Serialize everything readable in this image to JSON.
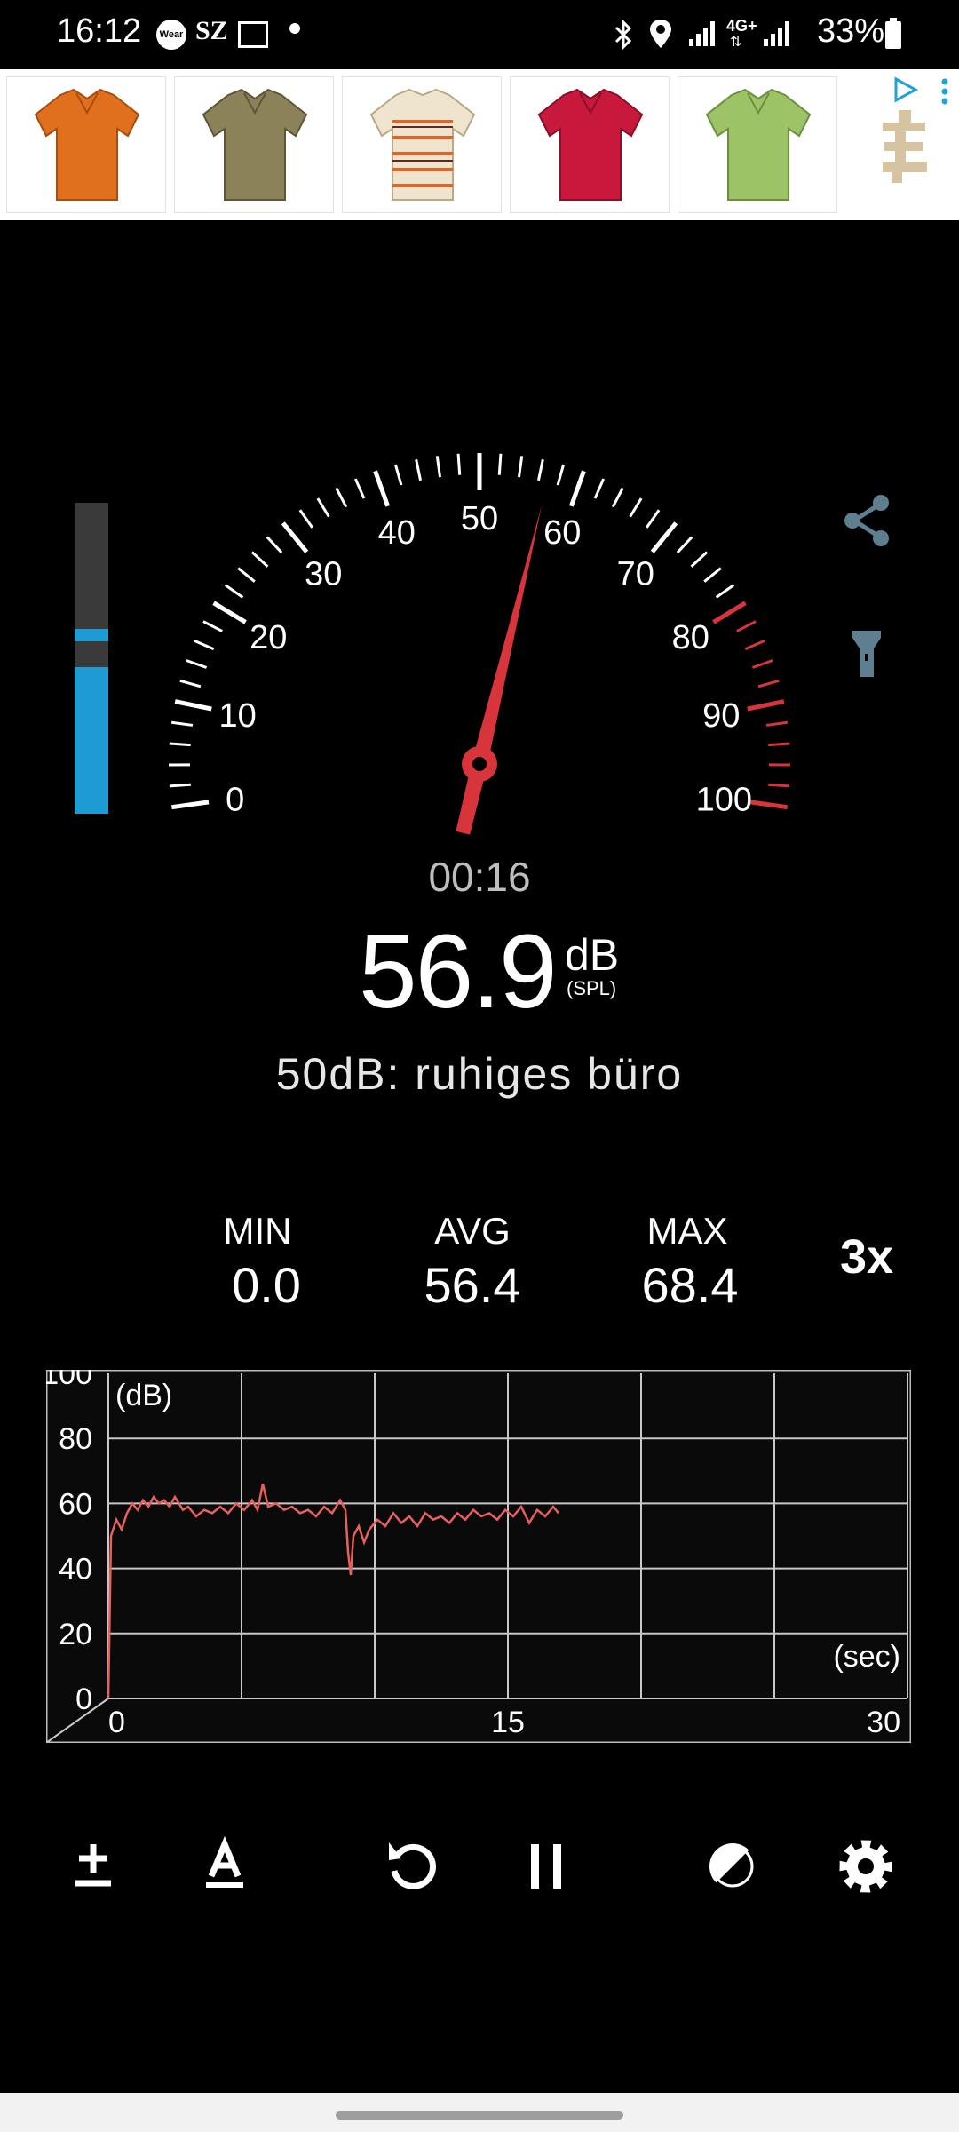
{
  "status_bar": {
    "time": "16:12",
    "wear_label": "Wear",
    "sz_label": "SZ",
    "network": "4G+",
    "battery": "33%"
  },
  "ad": {
    "items": [
      {
        "name": "orange-polo",
        "color": "#e0701e"
      },
      {
        "name": "olive-polo",
        "color": "#8c8259"
      },
      {
        "name": "striped-tshirt",
        "color": "#efe5cf"
      },
      {
        "name": "red-polo",
        "color": "#c8193c"
      },
      {
        "name": "green-polo",
        "color": "#9cc466"
      }
    ],
    "icons": [
      "ad-choices-icon",
      "more-vert-icon",
      "brand-logo"
    ]
  },
  "meter": {
    "gauge_labels": [
      "0",
      "10",
      "20",
      "30",
      "40",
      "50",
      "60",
      "70",
      "80",
      "90",
      "100"
    ],
    "needle_value": 56.9,
    "level_value": 56.9,
    "level_peak": 62,
    "timer": "00:16",
    "reading": "56.9",
    "unit": "dB",
    "unit_sub": "(SPL)",
    "reference": "50dB: ruhiges büro",
    "accent_red": "#d8343c",
    "accent_blue": "#1e9bd3"
  },
  "stats": {
    "min_label": "MIN",
    "min_value": "0.0",
    "avg_label": "AVG",
    "avg_value": "56.4",
    "max_label": "MAX",
    "max_value": "68.4",
    "multiplier": "3x"
  },
  "history": {
    "y_unit": "(dB)",
    "x_unit": "(sec)",
    "y_ticks": [
      "100",
      "80",
      "60",
      "40",
      "20",
      "0"
    ],
    "x_ticks": [
      "0",
      "15",
      "30"
    ]
  },
  "chart_data": {
    "type": "line",
    "title": "",
    "xlabel": "(sec)",
    "ylabel": "(dB)",
    "xlim": [
      0,
      30
    ],
    "ylim": [
      0,
      100
    ],
    "grid": true,
    "series": [
      {
        "values": [
          [
            0,
            0
          ],
          [
            0.1,
            50
          ],
          [
            0.3,
            55
          ],
          [
            0.5,
            52
          ],
          [
            0.7,
            57
          ],
          [
            0.9,
            60
          ],
          [
            1.1,
            58
          ],
          [
            1.3,
            61
          ],
          [
            1.5,
            59
          ],
          [
            1.7,
            62
          ],
          [
            1.9,
            60
          ],
          [
            2.1,
            61
          ],
          [
            2.3,
            59
          ],
          [
            2.5,
            62
          ],
          [
            2.8,
            58
          ],
          [
            3.0,
            59
          ],
          [
            3.3,
            56
          ],
          [
            3.6,
            58
          ],
          [
            3.9,
            57
          ],
          [
            4.2,
            59
          ],
          [
            4.5,
            57
          ],
          [
            4.8,
            60
          ],
          [
            5.1,
            58
          ],
          [
            5.4,
            61
          ],
          [
            5.6,
            58
          ],
          [
            5.8,
            66
          ],
          [
            6.0,
            59
          ],
          [
            6.3,
            60
          ],
          [
            6.6,
            58
          ],
          [
            6.9,
            59
          ],
          [
            7.2,
            57
          ],
          [
            7.5,
            58
          ],
          [
            7.8,
            56
          ],
          [
            8.1,
            59
          ],
          [
            8.4,
            57
          ],
          [
            8.7,
            61
          ],
          [
            8.9,
            58
          ],
          [
            9.0,
            45
          ],
          [
            9.1,
            38
          ],
          [
            9.2,
            50
          ],
          [
            9.4,
            53
          ],
          [
            9.6,
            48
          ],
          [
            9.8,
            52
          ],
          [
            10.1,
            55
          ],
          [
            10.4,
            53
          ],
          [
            10.7,
            57
          ],
          [
            11.0,
            54
          ],
          [
            11.3,
            56
          ],
          [
            11.6,
            53
          ],
          [
            11.9,
            57
          ],
          [
            12.2,
            55
          ],
          [
            12.5,
            56
          ],
          [
            12.8,
            54
          ],
          [
            13.1,
            57
          ],
          [
            13.4,
            55
          ],
          [
            13.7,
            58
          ],
          [
            14.0,
            56
          ],
          [
            14.3,
            57
          ],
          [
            14.6,
            55
          ],
          [
            14.9,
            58
          ],
          [
            15.2,
            56
          ],
          [
            15.5,
            59
          ],
          [
            15.8,
            54
          ],
          [
            16.1,
            58
          ],
          [
            16.4,
            56
          ],
          [
            16.7,
            59
          ],
          [
            16.9,
            57
          ]
        ]
      }
    ]
  },
  "toolbar": {
    "icons": [
      "calibration-plus-minus-icon",
      "weighting-a-icon",
      "reset-icon",
      "pause-icon",
      "theme-contrast-icon",
      "settings-gear-icon"
    ]
  }
}
